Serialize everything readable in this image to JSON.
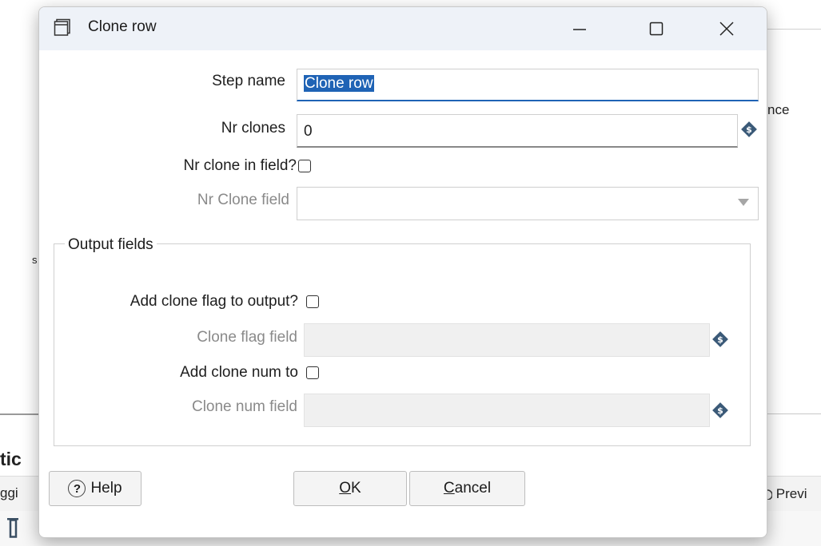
{
  "background": {
    "top_right_fragment": "nce",
    "left_fragment": "s",
    "section_fragment": "tic",
    "tab_left_fragment": "ggi",
    "tab_right_fragment": "Previ"
  },
  "dialog": {
    "title": "Clone row",
    "window_controls": {
      "minimize": "—",
      "maximize": "□",
      "close": "✕"
    },
    "fields": {
      "step_name": {
        "label": "Step name",
        "value": "Clone row"
      },
      "nr_clones": {
        "label": "Nr clones",
        "value": "0"
      },
      "nr_clone_in_field": {
        "label": "Nr clone in field?",
        "checked": false
      },
      "nr_clone_field": {
        "label": "Nr Clone field",
        "value": ""
      }
    },
    "output_fields": {
      "legend": "Output fields",
      "add_clone_flag": {
        "label": "Add clone flag to output?",
        "checked": false
      },
      "clone_flag_field": {
        "label": "Clone flag field",
        "value": ""
      },
      "add_clone_num": {
        "label": "Add clone num to",
        "checked": false
      },
      "clone_num_field": {
        "label": "Clone num field",
        "value": ""
      }
    },
    "buttons": {
      "help": "Help",
      "ok": "OK",
      "cancel": "Cancel"
    }
  },
  "colors": {
    "accent": "#1f63b5",
    "titlebar": "#eef2f8",
    "variable_icon": "#3b5a78"
  },
  "icons": [
    "window-icon",
    "minimize-icon",
    "maximize-icon",
    "close-icon",
    "variable-icon",
    "dropdown-arrow-icon",
    "help-icon",
    "gear-icon",
    "trash-icon",
    "preview-icon"
  ]
}
